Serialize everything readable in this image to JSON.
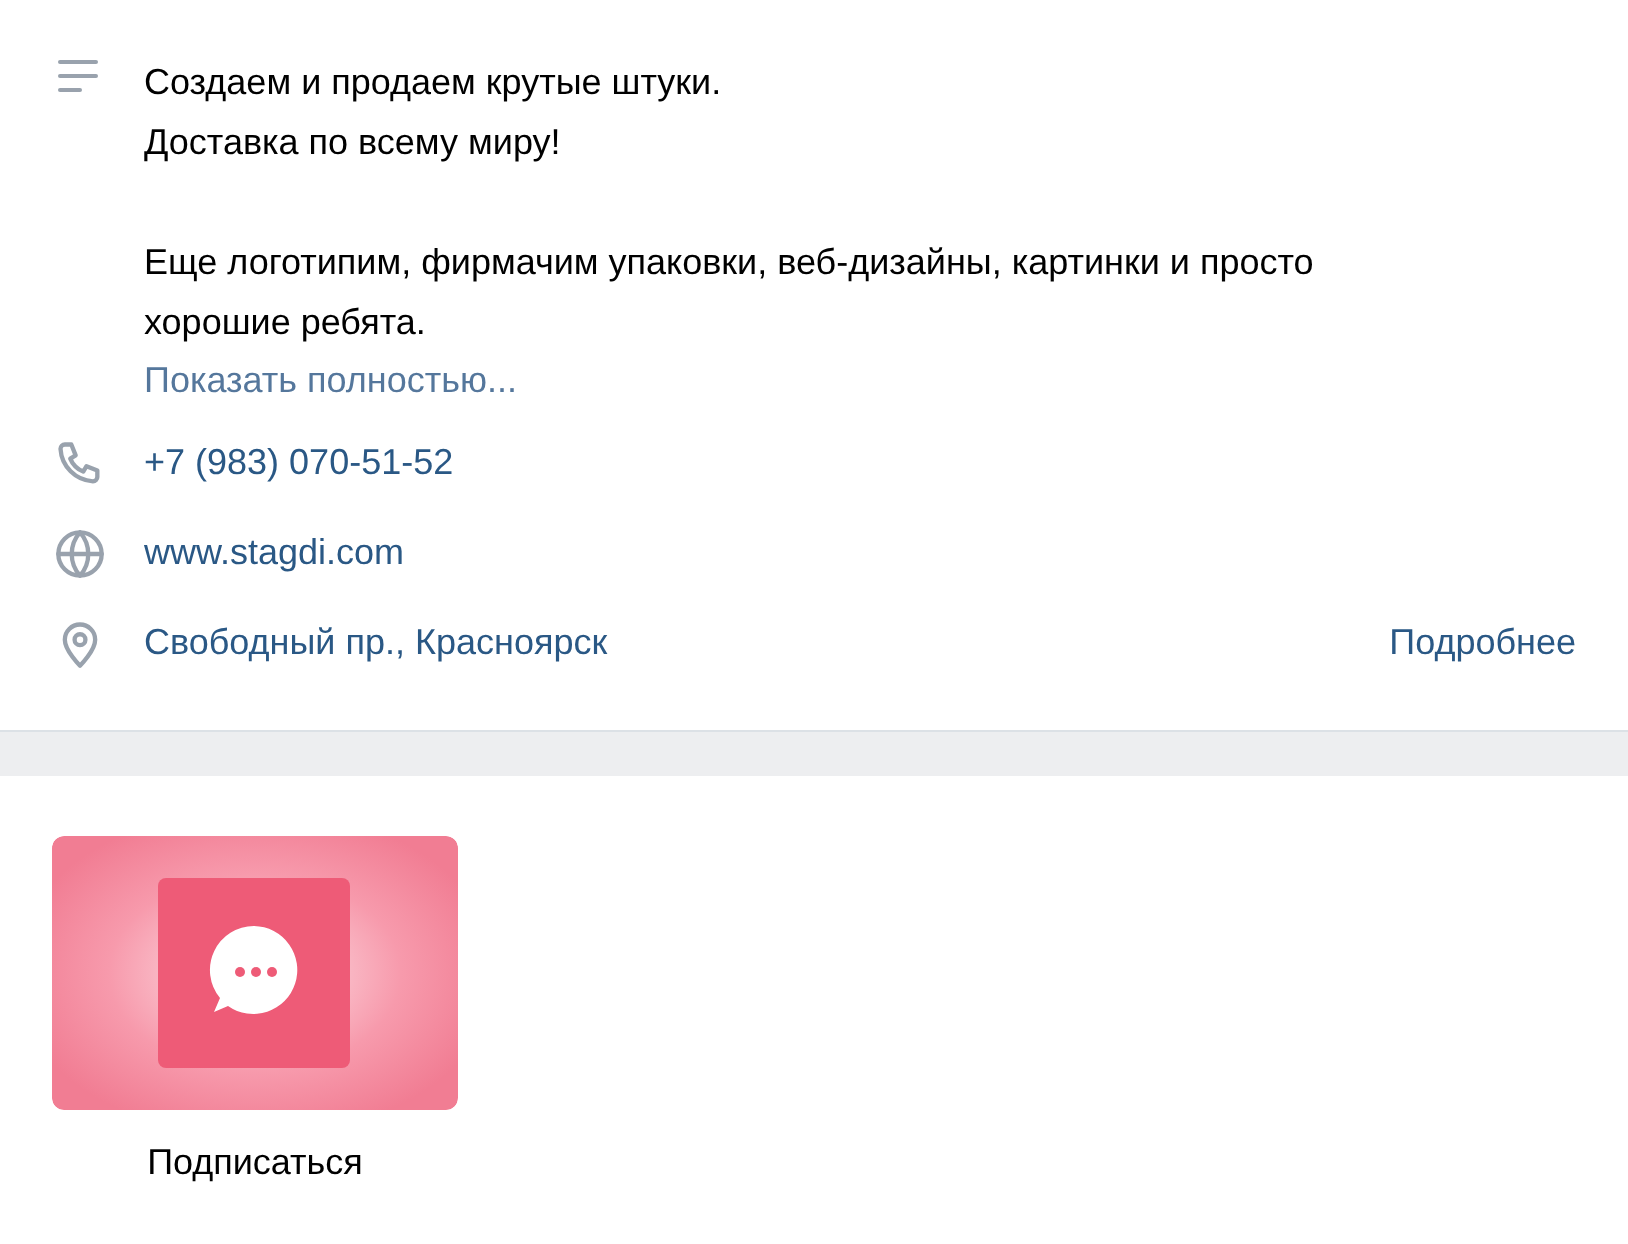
{
  "description": {
    "paragraphs": [
      "Создаем и продаем крутые штуки.\nДоставка по всему миру!",
      "Еще логотипим, фирмачим упаковки, веб-дизайны, картинки и просто хорошие ребята."
    ],
    "more_link": "Показать полностью..."
  },
  "contacts": [
    {
      "kind": "phone",
      "text": "+7 (983) 070-51-52"
    },
    {
      "kind": "site",
      "text": "www.stagdi.com"
    },
    {
      "kind": "address",
      "text": "Свободный пр., Красноярск",
      "action": "Подробнее"
    }
  ],
  "widgets": [
    {
      "label": "Подписаться"
    }
  ]
}
